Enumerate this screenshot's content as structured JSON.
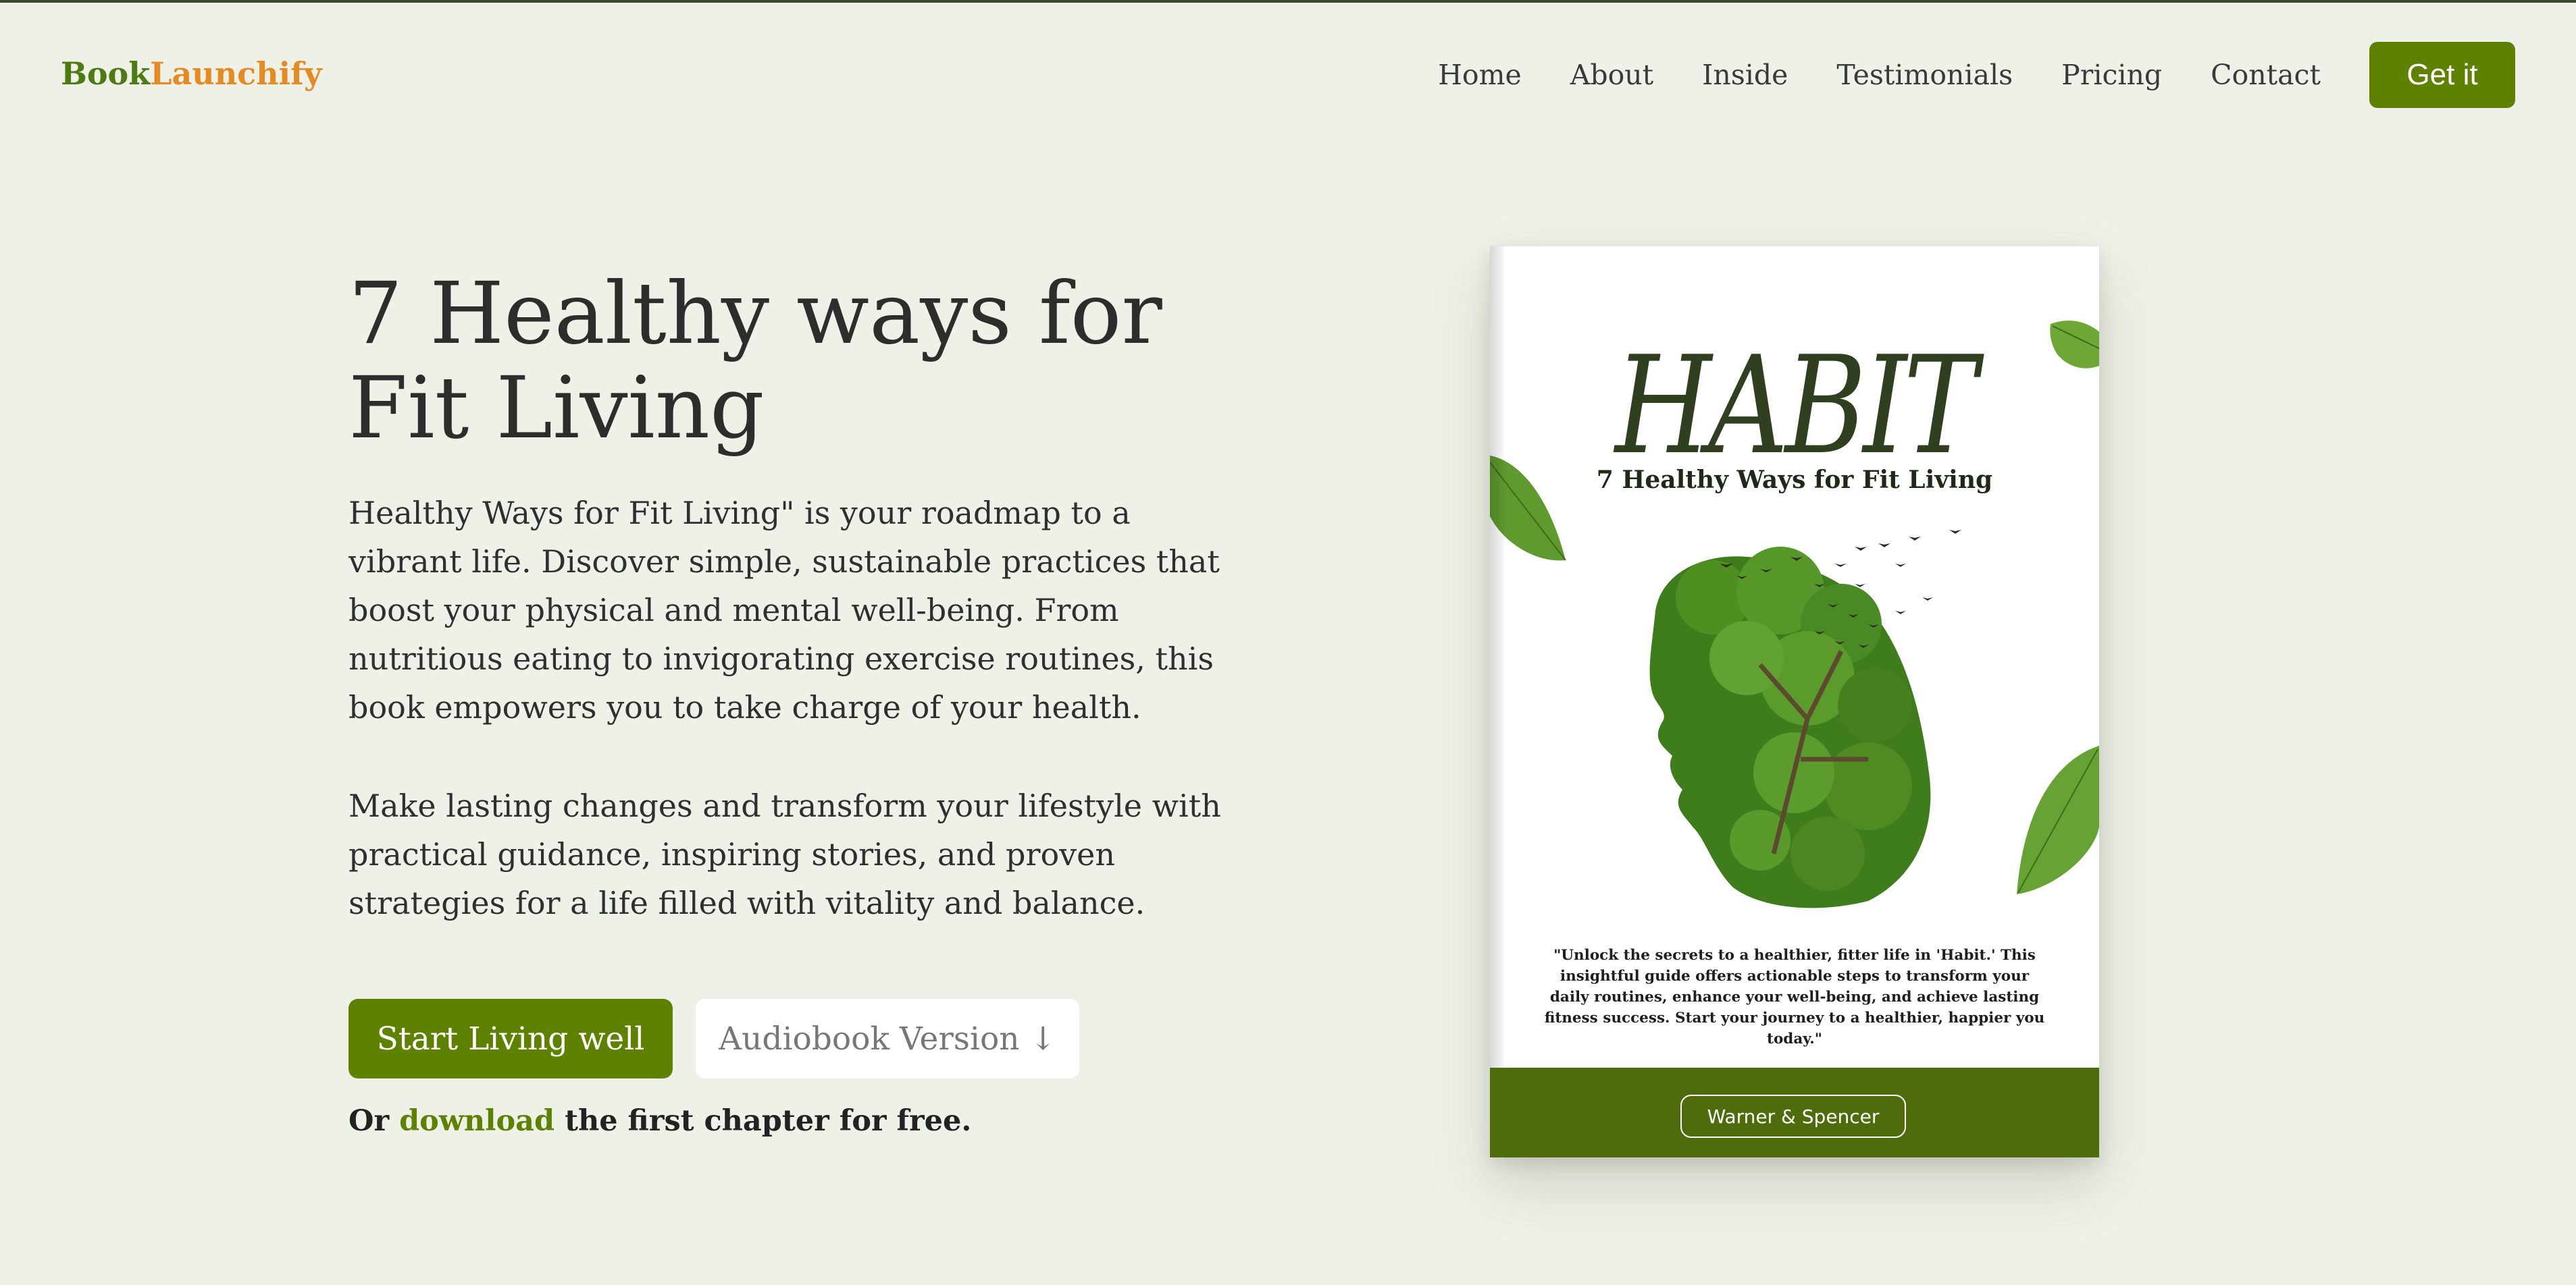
{
  "brand": {
    "part1": "Book",
    "part2": "Launchify"
  },
  "nav": {
    "items": [
      "Home",
      "About",
      "Inside",
      "Testimonials",
      "Pricing",
      "Contact"
    ],
    "cta": "Get it"
  },
  "hero": {
    "title": "7 Healthy ways for Fit Living",
    "paragraph1": "Healthy Ways for Fit Living\" is your roadmap to a vibrant life. Discover simple, sustainable practices that boost your physical and mental well-being. From nutritious eating to invigorating exercise routines, this book empowers you to take charge of your health.",
    "paragraph2": "Make lasting changes and transform your lifestyle with practical guidance, inspiring stories, and proven strategies for a life filled with vitality and balance.",
    "primary_button": "Start Living well",
    "secondary_button": "Audiobook Version ↓",
    "download": {
      "prefix": "Or",
      "link": "download",
      "suffix": "the first chapter for free."
    }
  },
  "book": {
    "title": "HABIT",
    "subtitle": "7 Healthy Ways for Fit Living",
    "quote": "\"Unlock the secrets to a healthier, fitter life in 'Habit.' This insightful guide offers actionable steps to transform your daily routines, enhance your well-being, and achieve lasting fitness success. Start your journey to a healthier, happier you today.\"",
    "publisher": "Warner & Spencer"
  },
  "colors": {
    "background": "#eef1e8",
    "accent_green": "#5e8100",
    "brand_orange": "#e68a22",
    "cover_band": "#4f6c0c"
  }
}
